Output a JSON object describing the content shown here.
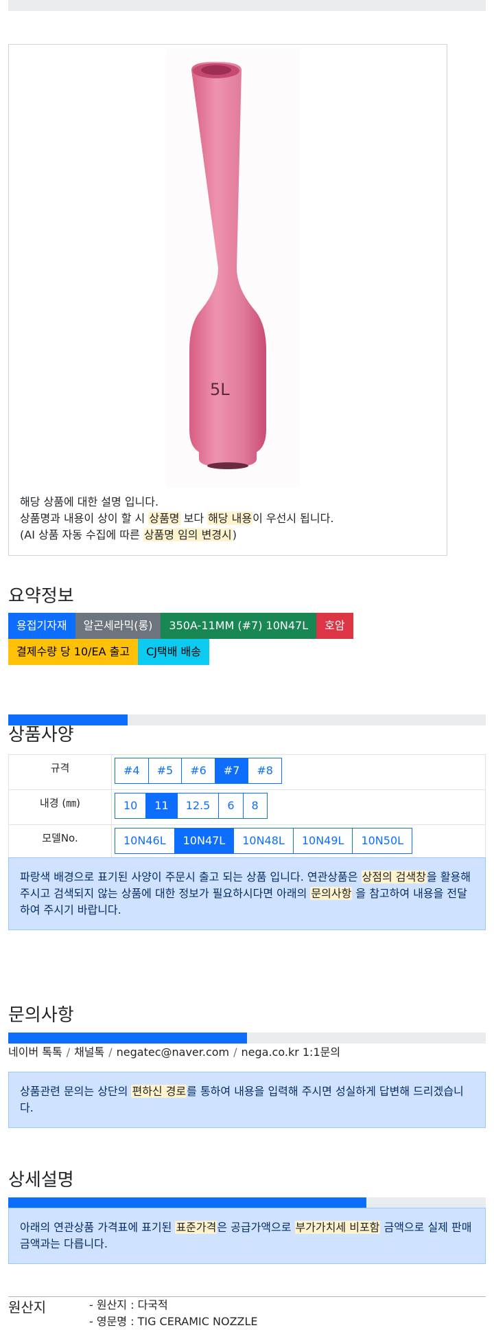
{
  "product_image": {
    "label": "5L",
    "color": "#e07a9a"
  },
  "description": {
    "line1": "해당 상품에 대한 설명 입니다.",
    "line2_a": "상품명과 내용이 상이 할 시 ",
    "line2_mark1": "상품명",
    "line2_b": " 보다 ",
    "line2_mark2": "해당 내용",
    "line2_c": "이 우선시 됩니다.",
    "line3_a": "(AI 상품 자동 수집에 따른 ",
    "line3_mark": "상품명 임의 변경시",
    "line3_b": ")"
  },
  "summary": {
    "title": "요약정보",
    "tags_row1": [
      "용접기자재",
      "알곤세라믹(롱)",
      "350A-11MM (#7) 10N47L",
      "호암"
    ],
    "tags_row2": [
      "결제수량 당 10/EA 출고",
      "CJ택배 배송"
    ]
  },
  "spec": {
    "progress": 0.25,
    "title": "상품사양",
    "rows": [
      {
        "label": "규격",
        "options": [
          "#4",
          "#5",
          "#6",
          "#7",
          "#8"
        ],
        "selected": "#7"
      },
      {
        "label": "내경 (㎜)",
        "options": [
          "10",
          "11",
          "12.5",
          "6",
          "8"
        ],
        "selected": "11"
      },
      {
        "label": "모델No.",
        "options": [
          "10N46L",
          "10N47L",
          "10N48L",
          "10N49L",
          "10N50L"
        ],
        "selected": "10N47L"
      }
    ],
    "notice_a": "파랑색 배경으로 표기된 사양이 주문시 출고 되는 상품 입니다. 연관상품은 ",
    "notice_mark1": "상점의 검색창",
    "notice_b": "을 활용해 주시고 검색되지 않는 상품에 대한 정보가 필요하시다면 아래의 ",
    "notice_mark2": "문의사항",
    "notice_c": " 을 참고하여 내용을 전달하여 주시기 바랍니다."
  },
  "inquiry": {
    "title": "문의사항",
    "progress": 0.5,
    "links": [
      "네이버 톡톡",
      "채널톡",
      "negatec@naver.com",
      "nega.co.kr 1:1문의"
    ],
    "separator": "/",
    "notice_a": "상품관련 문의는 상단의 ",
    "notice_mark": "편하신 경로",
    "notice_b": "를 통하여 내용을 입력해 주시면 성실하게 답변해 드리겠습니다."
  },
  "detail": {
    "title": "상세설명",
    "progress": 0.75,
    "notice_a": "아래의 연관상품 가격표에 표기된 ",
    "notice_mark1": "표준가격",
    "notice_b": "은 공급가액으로 ",
    "notice_mark2": "부가가치세 비포함",
    "notice_c": " 금액으로 실제 판매금액과는 다릅니다."
  },
  "origin": {
    "label": "원산지",
    "line1": "- 원산지 : 다국적",
    "line2": "- 영문명 : TIG CERAMIC NOZZLE"
  }
}
